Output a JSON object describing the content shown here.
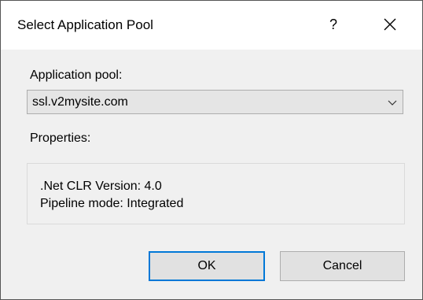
{
  "dialog": {
    "title": "Select Application Pool",
    "help_label": "?",
    "close_icon": "close-icon"
  },
  "form": {
    "pool_label": "Application pool:",
    "pool_selected": "ssl.v2mysite.com",
    "dropdown_icon": "chevron-down-icon",
    "properties_label": "Properties:",
    "properties": [
      ".Net CLR Version: 4.0",
      "Pipeline mode: Integrated"
    ]
  },
  "buttons": {
    "ok_label": "OK",
    "cancel_label": "Cancel"
  },
  "colors": {
    "default_button_border": "#0078d7",
    "dialog_background": "#f0f0f0",
    "title_background": "#ffffff"
  }
}
